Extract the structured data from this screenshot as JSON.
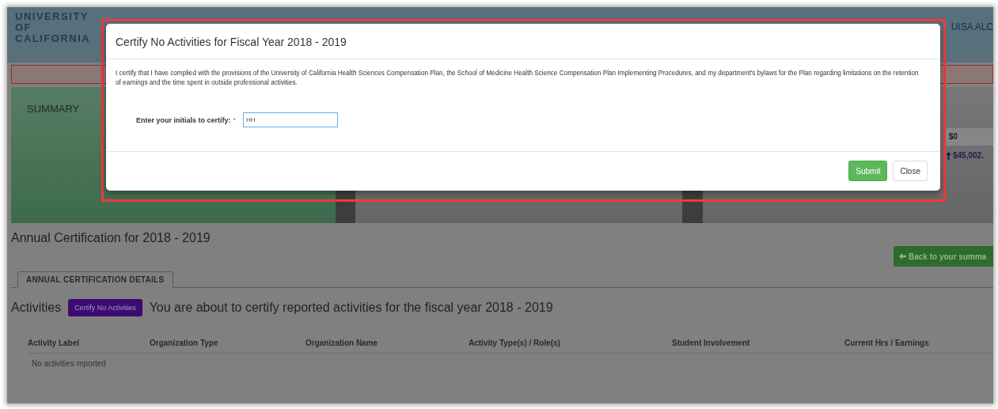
{
  "header": {
    "logo_lines": [
      "UNIVERSITY",
      "OF",
      "CALIFORNIA"
    ],
    "welcome": "UISA ALC"
  },
  "summary": {
    "title": "SUMMARY",
    "amount_field": "$0",
    "change_link": "$45,002."
  },
  "page": {
    "title": "Annual Certification for 2018 - 2019",
    "back_button": "Back to your summa",
    "tabs": [
      {
        "label": "ANNUAL CERTIFICATION DETAILS",
        "selected": true
      }
    ],
    "activities_label": "Activities",
    "certify_button": "Certify No Activities",
    "notice": "You are about to certify reported activities for the fiscal year 2018 - 2019",
    "table": {
      "columns": [
        "Activity Label",
        "Organization Type",
        "Organization Name",
        "Activity Type(s) / Role(s)",
        "Student Involvement",
        "Current Hrs / Earnings"
      ],
      "empty_message": "No activities reported"
    }
  },
  "modal": {
    "title": "Certify No Activities for Fiscal Year 2018 - 2019",
    "statement": "I certify that I have complied with the provisions of the University of California Health Sciences Compensation Plan, the School of Medicine Health Science Compensation Plan Implementing Procedures, and my department's bylaws for the Plan regarding limitations on the retention of earnings and the time spent in outside professional activities.",
    "initials_label": "Enter your initials to certify:",
    "required_mark": "*",
    "initials_value": "HH",
    "buttons": [
      {
        "label": "Submit",
        "kind": "primary"
      },
      {
        "label": "Close",
        "kind": "default"
      }
    ]
  }
}
